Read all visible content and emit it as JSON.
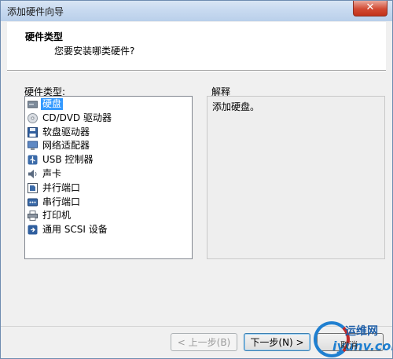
{
  "window": {
    "title": "添加硬件向导",
    "close_glyph": "✕"
  },
  "header": {
    "title": "硬件类型",
    "subtitle": "您要安装哪类硬件?"
  },
  "list": {
    "label": "硬件类型:",
    "selected_index": 0,
    "items": [
      {
        "label": "硬盘",
        "icon": "hard-disk-icon"
      },
      {
        "label": "CD/DVD 驱动器",
        "icon": "cd-dvd-icon"
      },
      {
        "label": "软盘驱动器",
        "icon": "floppy-icon"
      },
      {
        "label": "网络适配器",
        "icon": "network-adapter-icon"
      },
      {
        "label": "USB 控制器",
        "icon": "usb-icon"
      },
      {
        "label": "声卡",
        "icon": "sound-card-icon"
      },
      {
        "label": "并行端口",
        "icon": "parallel-port-icon"
      },
      {
        "label": "串行端口",
        "icon": "serial-port-icon"
      },
      {
        "label": "打印机",
        "icon": "printer-icon"
      },
      {
        "label": "通用 SCSI 设备",
        "icon": "scsi-icon"
      }
    ]
  },
  "explanation": {
    "label": "解释",
    "text": "添加硬盘。"
  },
  "buttons": {
    "back": "< 上一步(B)",
    "next": "下一步(N) >",
    "cancel": "取消"
  },
  "watermark": {
    "cn": "运维网",
    "en": "iyunv.com"
  }
}
